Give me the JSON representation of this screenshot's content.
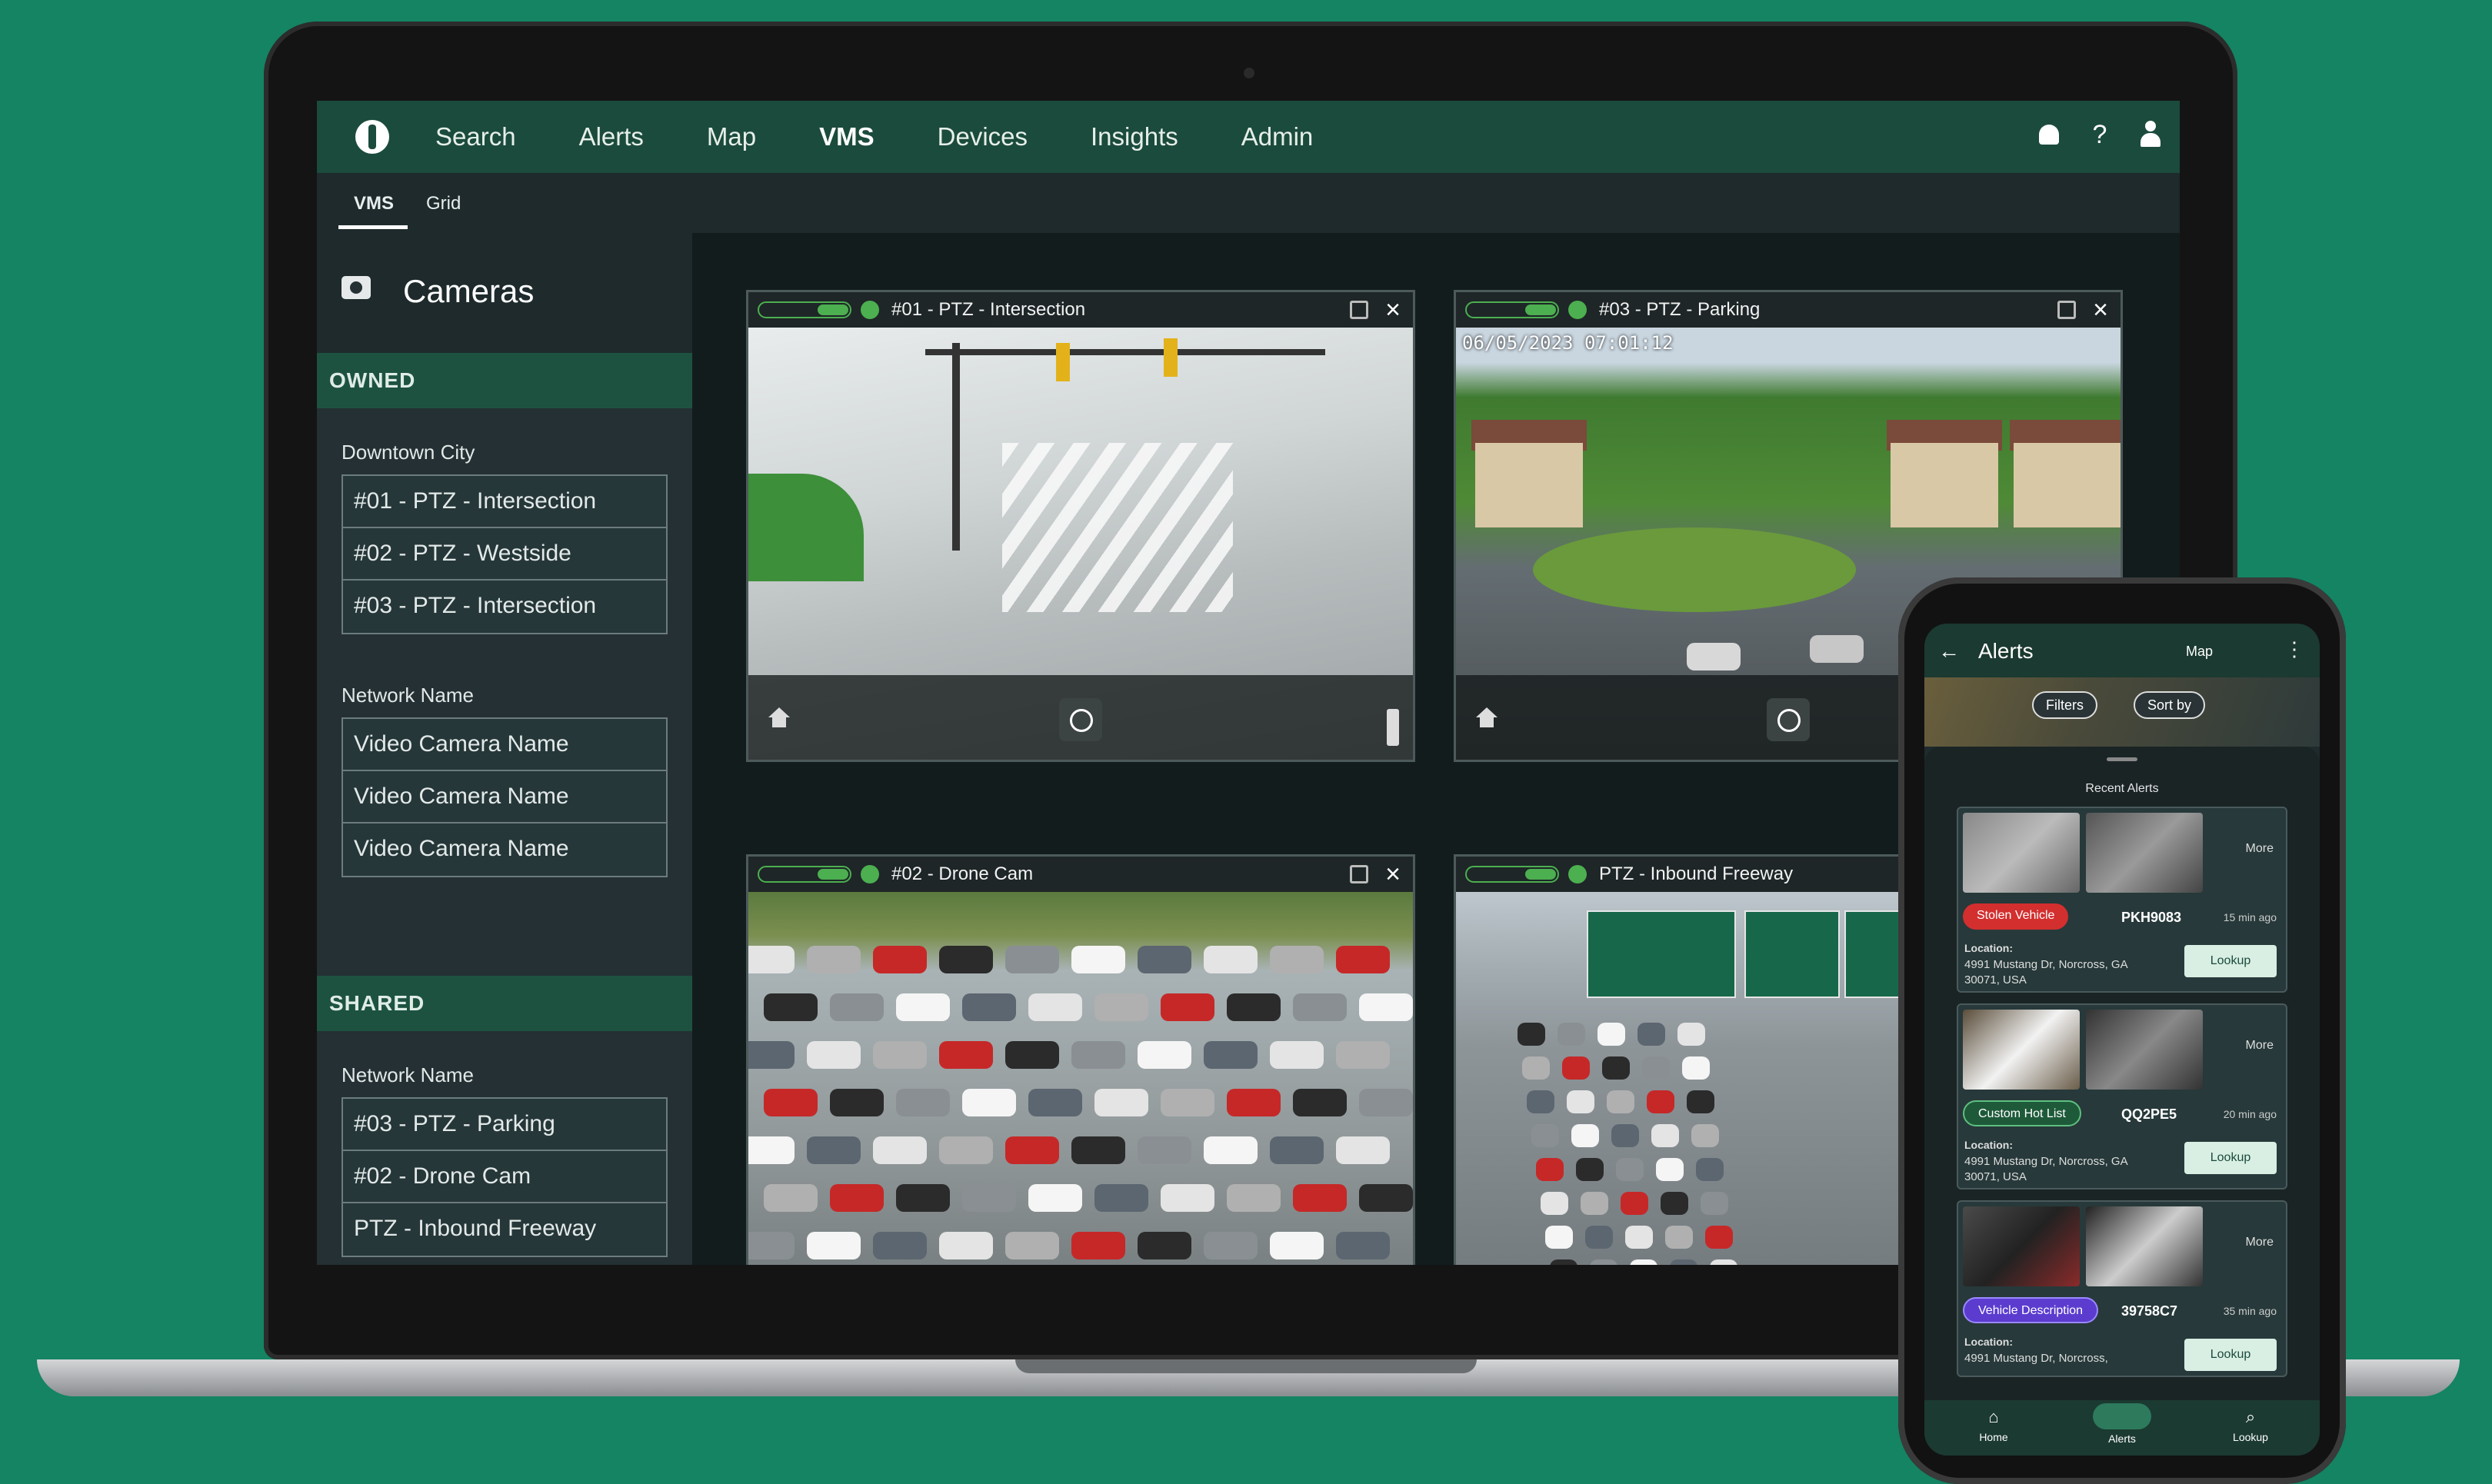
{
  "nav": {
    "items": [
      "Search",
      "Alerts",
      "Map",
      "VMS",
      "Devices",
      "Insights",
      "Admin"
    ],
    "active": "VMS",
    "help_glyph": "?"
  },
  "subtabs": {
    "vms": "VMS",
    "grid": "Grid"
  },
  "sidebar": {
    "title": "Cameras",
    "owned_label": "OWNED",
    "shared_label": "SHARED",
    "groups": [
      {
        "name": "Downtown City",
        "cameras": [
          "#01 - PTZ -  Intersection",
          "#02 - PTZ - Westside",
          "#03 - PTZ - Intersection"
        ]
      },
      {
        "name": "Network Name",
        "cameras": [
          "Video Camera Name",
          "Video Camera Name",
          "Video Camera Name"
        ]
      },
      {
        "name": "Network Name",
        "cameras": [
          "#03 - PTZ - Parking",
          "#02 - Drone Cam",
          "PTZ - Inbound Freeway"
        ]
      }
    ]
  },
  "tiles": [
    {
      "title": "#01 - PTZ - Intersection"
    },
    {
      "title": "#03 - PTZ - Parking",
      "timestamp": "06/05/2023 07:01:12"
    },
    {
      "title": "#02 - Drone Cam"
    },
    {
      "title": "PTZ - Inbound Freeway"
    }
  ],
  "colors": {
    "brand": "#1b4b3d",
    "accent": "#1d5241",
    "rec": "#4caf50"
  },
  "phone": {
    "title": "Alerts",
    "map_label": "Map",
    "filters": "Filters",
    "sort": "Sort by",
    "recent": "Recent Alerts",
    "location_label": "Location:",
    "more_label": "More",
    "lookup_label": "Lookup",
    "alerts": [
      {
        "tag": "Stolen Vehicle",
        "plate": "PKH9083",
        "ago": "15 min ago",
        "address": "4991 Mustang Dr, Norcross, GA 30071, USA"
      },
      {
        "tag": "Custom Hot List",
        "plate": "QQ2PE5",
        "ago": "20 min ago",
        "address": "4991 Mustang Dr, Norcross, GA 30071, USA"
      },
      {
        "tag": "Vehicle Description",
        "plate": "39758C7",
        "ago": "35 min ago",
        "address": "4991 Mustang Dr, Norcross,"
      }
    ],
    "tabs": [
      "Home",
      "Alerts",
      "Lookup"
    ]
  }
}
